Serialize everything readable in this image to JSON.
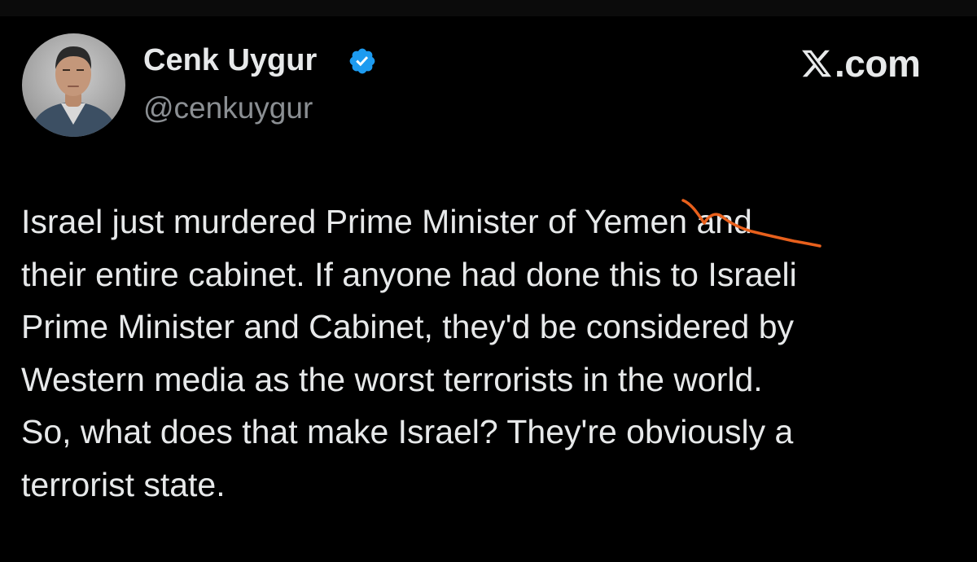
{
  "author": {
    "display_name": "Cenk Uygur",
    "handle": "@cenkuygur",
    "verified_icon": "verified-badge-icon",
    "avatar_icon": "profile-photo-avatar"
  },
  "brand": {
    "icon": "x-logo-icon",
    "text": ".com"
  },
  "tweet": {
    "lines": [
      "Israel just murdered Prime Minister of Yemen and",
      "their entire cabinet. If anyone had done this to Israeli",
      "Prime Minister and Cabinet, they'd be considered by",
      "Western media as the worst terrorists in the world.",
      "So, what does that make Israel? They're obviously a",
      "terrorist state."
    ]
  },
  "annotation": {
    "type": "orange-scribble-over-yemen",
    "color": "#e8601c"
  },
  "colors": {
    "background": "#000000",
    "text": "#e7e9ea",
    "secondary_text": "#8b8f93",
    "verified_blue": "#1d9bf0"
  }
}
